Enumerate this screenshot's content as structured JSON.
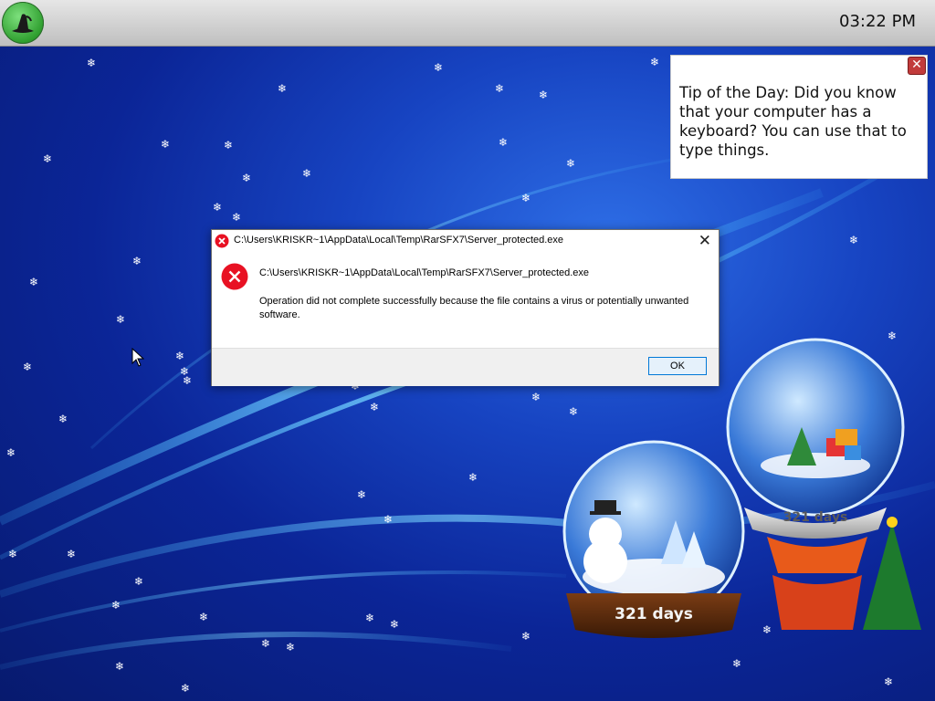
{
  "taskbar": {
    "start_icon": "witch-hat-icon",
    "clock": "03:22 PM"
  },
  "tip_window": {
    "close_icon": "close-icon",
    "text": "Tip of the Day: Did you know that your computer has a keyboard? You can use that to type things."
  },
  "dialog": {
    "title": "C:\\Users\\KRISKR~1\\AppData\\Local\\Temp\\RarSFX7\\Server_protected.exe",
    "file_path": "C:\\Users\\KRISKR~1\\AppData\\Local\\Temp\\RarSFX7\\Server_protected.exe",
    "message": "Operation did not complete successfully because the file contains a virus or potentially unwanted software.",
    "ok_label": "OK",
    "close_glyph": "✕",
    "icon": "error-icon"
  },
  "wallpaper": {
    "globe_left_counter": "321 days",
    "globe_right_counter": "321 days"
  },
  "colors": {
    "error_red": "#e81123",
    "accent_blue": "#0078d7"
  }
}
